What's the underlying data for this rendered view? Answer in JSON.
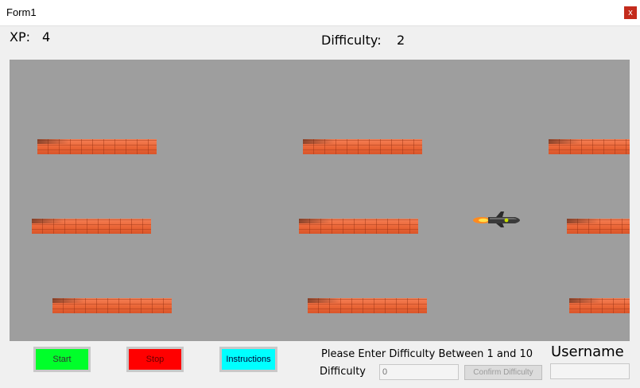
{
  "window": {
    "title": "Form1",
    "close_label": "x"
  },
  "hud": {
    "xp_label": "XP:",
    "xp_value": "4",
    "difficulty_label": "Difficulty:",
    "difficulty_value": "2"
  },
  "game": {
    "background": "#9e9e9e",
    "wall_color": "#ea6536",
    "walls_count_visible": 9,
    "player": "rocket"
  },
  "buttons": {
    "start": {
      "label": "Start",
      "color": "#00ff2a"
    },
    "stop": {
      "label": "Stop",
      "color": "#ff0000"
    },
    "instructions": {
      "label": "Instructions",
      "color": "#00ffff"
    }
  },
  "difficulty_panel": {
    "prompt": "Please Enter Difficulty Between 1 and 10",
    "label": "Difficulty",
    "input_placeholder": "0",
    "confirm_label": "Confirm Difficulty"
  },
  "username_panel": {
    "label": "Username",
    "input_value": ""
  }
}
